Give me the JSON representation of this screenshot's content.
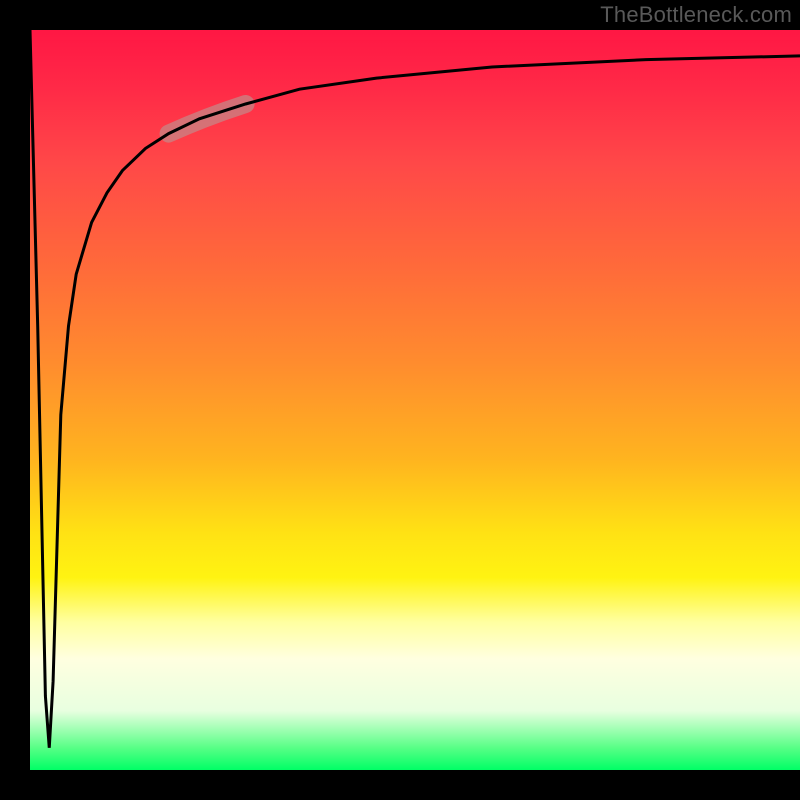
{
  "watermark": "TheBottleneck.com",
  "colors": {
    "gradient_top": "#ff1744",
    "gradient_mid": "#ffe214",
    "gradient_bottom": "#00ff66",
    "curve": "#000000",
    "highlight": "#c78686",
    "frame": "#000000"
  },
  "chart_data": {
    "type": "line",
    "title": "",
    "xlabel": "",
    "ylabel": "",
    "xlim": [
      0,
      100
    ],
    "ylim": [
      0,
      100
    ],
    "x": [
      0,
      1,
      2,
      2.5,
      3,
      3.5,
      4,
      5,
      6,
      8,
      10,
      12,
      15,
      18,
      22,
      28,
      35,
      45,
      60,
      80,
      100
    ],
    "values": [
      100,
      60,
      10,
      3,
      12,
      30,
      48,
      60,
      67,
      74,
      78,
      81,
      84,
      86,
      88,
      90,
      92,
      93.5,
      95,
      96,
      96.5
    ],
    "highlight_range_x": [
      18,
      28
    ],
    "notes": "Background vertical heat gradient from red (top, high bottleneck) to green (bottom, low bottleneck). Curve shows bottleneck percentage vs. an implicit x-axis (likely component pairing). A short pink highlighted segment marks a region around x≈18–28."
  }
}
